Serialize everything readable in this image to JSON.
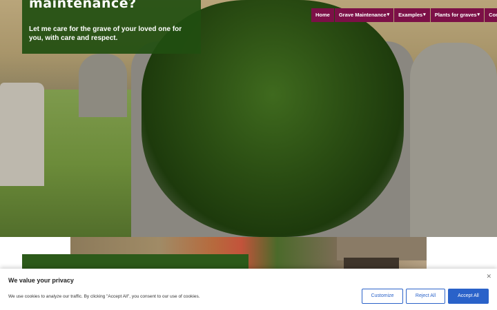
{
  "hero": {
    "heading": "maintenance?",
    "text": "Let me care for the grave of your loved one for you, with care and respect."
  },
  "nav": {
    "items": [
      {
        "label": "Home",
        "has_dropdown": false
      },
      {
        "label": "Grave Maintenance",
        "has_dropdown": true
      },
      {
        "label": "Examples",
        "has_dropdown": true
      },
      {
        "label": "Plants for graves",
        "has_dropdown": true
      },
      {
        "label": "Contact",
        "has_dropdown": false
      }
    ],
    "bg_color": "#7c1047"
  },
  "cookie": {
    "title": "We value your privacy",
    "message": "We use cookies to analyze our traffic. By clicking \"Accept All\", you consent to our use of cookies.",
    "close_icon": "close-icon",
    "customize_label": "Customize",
    "reject_label": "Reject All",
    "accept_label": "Accept All",
    "accent_color": "#2a62c9"
  },
  "colors": {
    "caption_bg": "#214e10",
    "nav_bg": "#7c1047"
  }
}
